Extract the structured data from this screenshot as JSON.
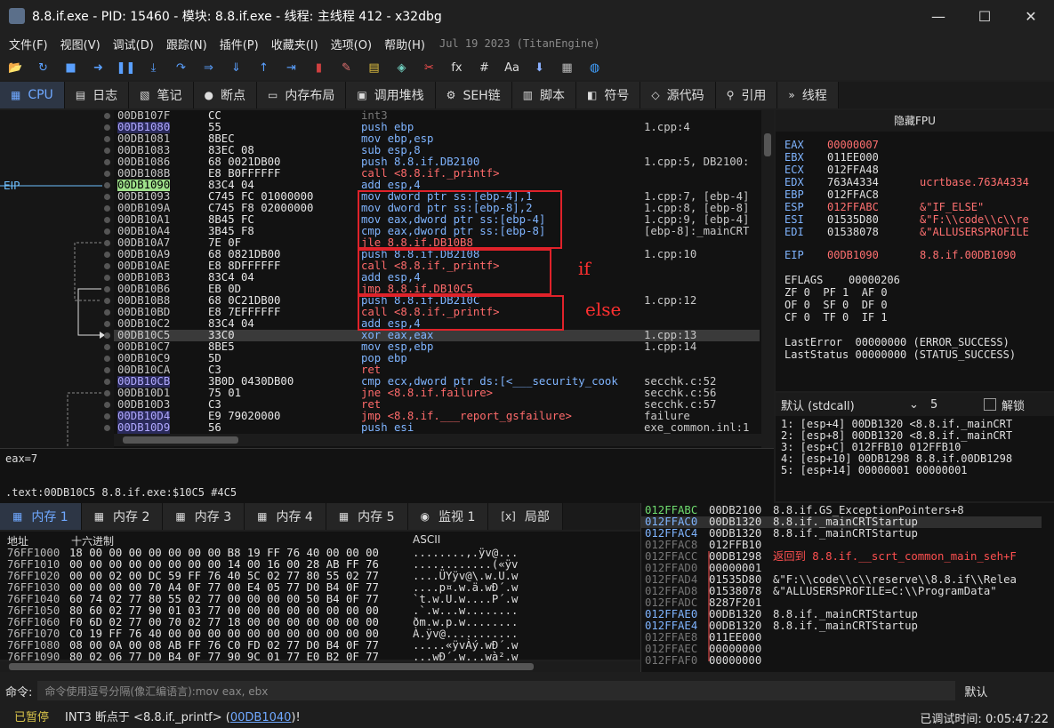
{
  "window": {
    "title": "8.8.if.exe - PID: 15460 - 模块: 8.8.if.exe - 线程: 主线程 412 - x32dbg",
    "min": "—",
    "max": "☐",
    "close": "✕"
  },
  "menu": [
    "文件(F)",
    "视图(V)",
    "调试(D)",
    "跟踪(N)",
    "插件(P)",
    "收藏夹(I)",
    "选项(O)",
    "帮助(H)"
  ],
  "engine_info": "Jul 19 2023 (TitanEngine)",
  "toolbar_icons": [
    "open-icon",
    "restart-icon",
    "stop-icon",
    "run-icon",
    "pause-icon",
    "step-into-icon",
    "step-over-icon",
    "trace-into-icon",
    "trace-over-icon",
    "run-to-return-icon",
    "run-to-user-icon",
    "patch-icon",
    "comment-icon",
    "label-icon",
    "bookmark-icon",
    "function-icon",
    "fx-icon",
    "hash-icon",
    "font-icon",
    "module-icon",
    "calculator-icon",
    "globe-icon"
  ],
  "toolbar_glyphs": [
    "📂",
    "↻",
    "■",
    "➜",
    "❚❚",
    "⤓",
    "↷",
    "⇒",
    "⇓",
    "↑",
    "⇥",
    "▮",
    "✎",
    "▤",
    "◈",
    "✂",
    "fx",
    "#",
    "Aa",
    "⬇",
    "▦",
    "◍"
  ],
  "tabs": [
    {
      "label": "CPU",
      "icon": "▦"
    },
    {
      "label": "日志",
      "icon": "▤"
    },
    {
      "label": "笔记",
      "icon": "▧"
    },
    {
      "label": "断点",
      "icon": "●"
    },
    {
      "label": "内存布局",
      "icon": "▭"
    },
    {
      "label": "调用堆栈",
      "icon": "▣"
    },
    {
      "label": "SEH链",
      "icon": "⚙"
    },
    {
      "label": "脚本",
      "icon": "▥"
    },
    {
      "label": "符号",
      "icon": "◧"
    },
    {
      "label": "源代码",
      "icon": "◇"
    },
    {
      "label": "引用",
      "icon": "⚲"
    },
    {
      "label": "线程",
      "icon": "»"
    }
  ],
  "eip_label": "EIP",
  "disasm": [
    {
      "addr": "00DB107F",
      "bytes": "CC",
      "asm": "int3",
      "cmt": "",
      "cls": "n",
      "k": "dim"
    },
    {
      "addr": "00DB1080",
      "bytes": "55",
      "asm": "push ebp",
      "cmt": "1.cpp:4",
      "cls": "hl",
      "k": "push"
    },
    {
      "addr": "00DB1081",
      "bytes": "8BEC",
      "asm": "mov ebp,esp",
      "cmt": "",
      "cls": "n",
      "k": "mov"
    },
    {
      "addr": "00DB1083",
      "bytes": "83EC 08",
      "asm": "sub esp,8",
      "cmt": "",
      "cls": "n",
      "k": "mov"
    },
    {
      "addr": "00DB1086",
      "bytes": "68 0021DB00",
      "asm": "push 8.8.if.DB2100",
      "cmt": "1.cpp:5, DB2100:",
      "cls": "n",
      "k": "push"
    },
    {
      "addr": "00DB108B",
      "bytes": "E8 B0FFFFFF",
      "asm": "call <8.8.if._printf>",
      "cmt": "",
      "cls": "n",
      "k": "call"
    },
    {
      "addr": "00DB1090",
      "bytes": "83C4 04",
      "asm": "add esp,4",
      "cmt": "",
      "cls": "eip",
      "k": "mov"
    },
    {
      "addr": "00DB1093",
      "bytes": "C745 FC 01000000",
      "asm": "mov dword ptr ss:[ebp-4],1",
      "cmt": "1.cpp:7, [ebp-4]",
      "cls": "n",
      "k": "mov"
    },
    {
      "addr": "00DB109A",
      "bytes": "C745 F8 02000000",
      "asm": "mov dword ptr ss:[ebp-8],2",
      "cmt": "1.cpp:8, [ebp-8]",
      "cls": "n",
      "k": "mov"
    },
    {
      "addr": "00DB10A1",
      "bytes": "8B45 FC",
      "asm": "mov eax,dword ptr ss:[ebp-4]",
      "cmt": "1.cpp:9, [ebp-4]",
      "cls": "n",
      "k": "mov"
    },
    {
      "addr": "00DB10A4",
      "bytes": "3B45 F8",
      "asm": "cmp eax,dword ptr ss:[ebp-8]",
      "cmt": "[ebp-8]:_mainCRT",
      "cls": "n",
      "k": "mov"
    },
    {
      "addr": "00DB10A7",
      "bytes": "7E 0F",
      "asm": "jle 8.8.if.DB10B8",
      "cmt": "",
      "cls": "n",
      "k": "jmp"
    },
    {
      "addr": "00DB10A9",
      "bytes": "68 0821DB00",
      "asm": "push 8.8.if.DB2108",
      "cmt": "1.cpp:10",
      "cls": "n",
      "k": "push"
    },
    {
      "addr": "00DB10AE",
      "bytes": "E8 8DFFFFFF",
      "asm": "call <8.8.if._printf>",
      "cmt": "",
      "cls": "n",
      "k": "call"
    },
    {
      "addr": "00DB10B3",
      "bytes": "83C4 04",
      "asm": "add esp,4",
      "cmt": "",
      "cls": "n",
      "k": "mov"
    },
    {
      "addr": "00DB10B6",
      "bytes": "EB 0D",
      "asm": "jmp 8.8.if.DB10C5",
      "cmt": "",
      "cls": "n",
      "k": "jmp"
    },
    {
      "addr": "00DB10B8",
      "bytes": "68 0C21DB00",
      "asm": "push 8.8.if.DB210C",
      "cmt": "1.cpp:12",
      "cls": "n",
      "k": "push"
    },
    {
      "addr": "00DB10BD",
      "bytes": "E8 7EFFFFFF",
      "asm": "call <8.8.if._printf>",
      "cmt": "",
      "cls": "n",
      "k": "call"
    },
    {
      "addr": "00DB10C2",
      "bytes": "83C4 04",
      "asm": "add esp,4",
      "cmt": "",
      "cls": "n",
      "k": "mov"
    },
    {
      "addr": "00DB10C5",
      "bytes": "33C0",
      "asm": "xor eax,eax",
      "cmt": "1.cpp:13",
      "cls": "n",
      "k": "mov",
      "cur": true
    },
    {
      "addr": "00DB10C7",
      "bytes": "8BE5",
      "asm": "mov esp,ebp",
      "cmt": "1.cpp:14",
      "cls": "n",
      "k": "mov"
    },
    {
      "addr": "00DB10C9",
      "bytes": "5D",
      "asm": "pop ebp",
      "cmt": "",
      "cls": "n",
      "k": "mov"
    },
    {
      "addr": "00DB10CA",
      "bytes": "C3",
      "asm": "ret",
      "cmt": "",
      "cls": "n",
      "k": "call"
    },
    {
      "addr": "00DB10CB",
      "bytes": "3B0D 0430DB00",
      "asm": "cmp ecx,dword ptr ds:[<___security_cook",
      "cmt": "secchk.c:52",
      "cls": "hl",
      "k": "mov"
    },
    {
      "addr": "00DB10D1",
      "bytes": "75 01",
      "asm": "jne <8.8.if.failure>",
      "cmt": "secchk.c:56",
      "cls": "n",
      "k": "jmp"
    },
    {
      "addr": "00DB10D3",
      "bytes": "C3",
      "asm": "ret",
      "cmt": "secchk.c:57",
      "cls": "n",
      "k": "call"
    },
    {
      "addr": "00DB10D4",
      "bytes": "E9 79020000",
      "asm": "jmp <8.8.if.___report_gsfailure>",
      "cmt": "failure",
      "cls": "hl",
      "k": "jmp"
    },
    {
      "addr": "00DB10D9",
      "bytes": "56",
      "asm": "push esi",
      "cmt": "exe_common.inl:1",
      "cls": "hl",
      "k": "push"
    }
  ],
  "annotations": {
    "if": "if",
    "else": "else"
  },
  "info": {
    "line1": "eax=7",
    "line2": ".text:00DB10C5 8.8.if.exe:$10C5 #4C5"
  },
  "fpu_header": "隐藏FPU",
  "registers": [
    {
      "n": "EAX",
      "v": "00000007",
      "c": ""
    },
    {
      "n": "EBX",
      "v": "011EE000",
      "c": ""
    },
    {
      "n": "ECX",
      "v": "012FFA48",
      "c": ""
    },
    {
      "n": "EDX",
      "v": "763A4334",
      "c": "ucrtbase.763A4334"
    },
    {
      "n": "EBP",
      "v": "012FFAC8",
      "c": ""
    },
    {
      "n": "ESP",
      "v": "012FFABC",
      "c": "&\"IF_ELSE\""
    },
    {
      "n": "ESI",
      "v": "01535D80",
      "c": "&\"F:\\\\code\\\\c\\\\re"
    },
    {
      "n": "EDI",
      "v": "01538078",
      "c": "&\"ALLUSERSPROFILE"
    }
  ],
  "eip_reg": {
    "n": "EIP",
    "v": "00DB1090",
    "c": "8.8.if.00DB1090"
  },
  "eflags": {
    "label": "EFLAGS",
    "v": "00000206",
    "rows": [
      "ZF 0  PF 1  AF 0",
      "OF 0  SF 0  DF 0",
      "CF 0  TF 0  IF 1"
    ]
  },
  "lasterror": "LastError  00000000 (ERROR_SUCCESS)",
  "laststatus": "LastStatus 00000000 (STATUS_SUCCESS)",
  "stack_header": {
    "conv": "默认 (stdcall)",
    "count": "5",
    "unlock": "解锁"
  },
  "stack_args": [
    "1: [esp+4] 00DB1320 <8.8.if._mainCRT",
    "2: [esp+8] 00DB1320 <8.8.if._mainCRT",
    "3: [esp+C] 012FFB10 012FFB10",
    "4: [esp+10] 00DB1298 8.8.if.00DB1298",
    "5: [esp+14] 00000001 00000001"
  ],
  "memtabs": [
    {
      "label": "内存 1",
      "icon": "▦"
    },
    {
      "label": "内存 2",
      "icon": "▦"
    },
    {
      "label": "内存 3",
      "icon": "▦"
    },
    {
      "label": "内存 4",
      "icon": "▦"
    },
    {
      "label": "内存 5",
      "icon": "▦"
    },
    {
      "label": "监视 1",
      "icon": "◉"
    },
    {
      "label": "局部",
      "icon": "[x]"
    }
  ],
  "dump_headers": {
    "addr": "地址",
    "hex": "十六进制",
    "ascii": "ASCII"
  },
  "dump": [
    {
      "a": "76FF1000",
      "x": "18 00 00 00 00 00 00 00 B8 19 FF 76 40 00 00 00",
      "s": "........,.ÿv@..."
    },
    {
      "a": "76FF1010",
      "x": "00 00 00 00 00 00 00 00 14 00 16 00 28 AB FF 76",
      "s": "............(«ÿv"
    },
    {
      "a": "76FF1020",
      "x": "00 00 02 00 DC 59 FF 76 40 5C 02 77 80 55 02 77",
      "s": "....ÜYÿv@\\.w.U.w"
    },
    {
      "a": "76FF1030",
      "x": "00 00 00 00 70 A4 0F 77 00 E4 05 77 D0 B4 0F 77",
      "s": "....p¤.w.ä.wÐ´.w"
    },
    {
      "a": "76FF1040",
      "x": "60 74 02 77 80 55 02 77 00 00 00 00 50 B4 0F 77",
      "s": "`t.w.U.w....P´.w"
    },
    {
      "a": "76FF1050",
      "x": "80 60 02 77 90 01 03 77 00 00 00 00 00 00 00 00",
      "s": ".`.w...w........"
    },
    {
      "a": "76FF1060",
      "x": "F0 6D 02 77 00 70 02 77 18 00 00 00 00 00 00 00",
      "s": "ðm.w.p.w........"
    },
    {
      "a": "76FF1070",
      "x": "C0 19 FF 76 40 00 00 00 00 00 00 00 00 00 00 00",
      "s": "À.ÿv@..........."
    },
    {
      "a": "76FF1080",
      "x": "08 00 0A 00 08 AB FF 76 C0 FD 02 77 D0 B4 0F 77",
      "s": ".....«ÿvÀý.wÐ´.w"
    },
    {
      "a": "76FF1090",
      "x": "80 02 06 77 D0 B4 0F 77 90 9C 01 77 E0 B2 0F 77",
      "s": "...wÐ´.w...wà².w"
    }
  ],
  "stack": [
    {
      "a": "012FFABC",
      "v": "00DB2100",
      "c": "8.8.if.GS_ExceptionPointers+8",
      "top": true
    },
    {
      "a": "012FFAC0",
      "v": "00DB1320",
      "c": "8.8.if._mainCRTStartup",
      "cur": true
    },
    {
      "a": "012FFAC4",
      "v": "00DB1320",
      "c": "8.8.if._mainCRTStartup",
      "hl": true
    },
    {
      "a": "012FFAC8",
      "v": "012FFB10",
      "c": ""
    },
    {
      "a": "012FFACC",
      "v": "00DB1298",
      "c": "返回到 8.8.if.__scrt_common_main_seh+F",
      "red": true
    },
    {
      "a": "012FFAD0",
      "v": "00000001",
      "c": ""
    },
    {
      "a": "012FFAD4",
      "v": "01535D80",
      "c": "&\"F:\\\\code\\\\c\\\\reserve\\\\8.8.if\\\\Relea"
    },
    {
      "a": "012FFAD8",
      "v": "01538078",
      "c": "&\"ALLUSERSPROFILE=C:\\\\ProgramData\""
    },
    {
      "a": "012FFADC",
      "v": "8287F201",
      "c": ""
    },
    {
      "a": "012FFAE0",
      "v": "00DB1320",
      "c": "8.8.if._mainCRTStartup",
      "hl": true
    },
    {
      "a": "012FFAE4",
      "v": "00DB1320",
      "c": "8.8.if._mainCRTStartup",
      "hl": true
    },
    {
      "a": "012FFAE8",
      "v": "011EE000",
      "c": ""
    },
    {
      "a": "012FFAEC",
      "v": "00000000",
      "c": ""
    },
    {
      "a": "012FFAF0",
      "v": "00000000",
      "c": ""
    }
  ],
  "command": {
    "label": "命令:",
    "placeholder": "命令使用逗号分隔(像汇编语言):mov eax, ebx",
    "mode": "默认"
  },
  "status": {
    "state": "已暂停",
    "msg_prefix": "INT3  断点于 <8.8.if._printf> (",
    "addr": "00DB1040",
    "msg_suffix": ")!",
    "timer_label": "已调试时间:",
    "timer": "0:05:47:22"
  },
  "colors": {
    "accent": "#6fa8ff",
    "eip": "#9ee08a",
    "call": "#ff6b6b",
    "annotation": "#ff3030"
  }
}
